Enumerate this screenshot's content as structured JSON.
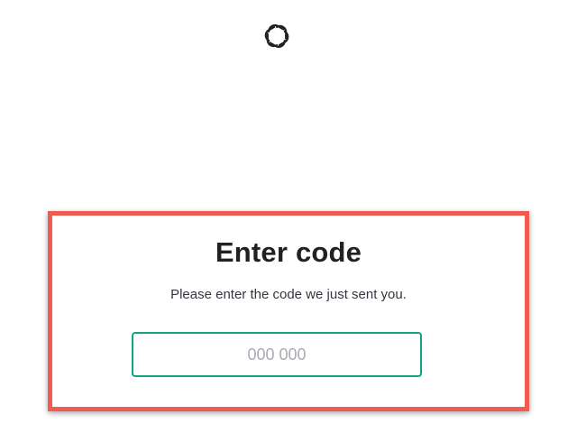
{
  "logo": {
    "icon": "openai-logo-icon"
  },
  "main": {
    "title": "Enter code",
    "subtitle": "Please enter the code we just sent you.",
    "code_input": {
      "placeholder": "000 000",
      "value": ""
    }
  },
  "colors": {
    "accent": "#10a37f",
    "highlight_border": "#f05a4f",
    "text": "#202123",
    "placeholder": "#a9a9b3"
  }
}
